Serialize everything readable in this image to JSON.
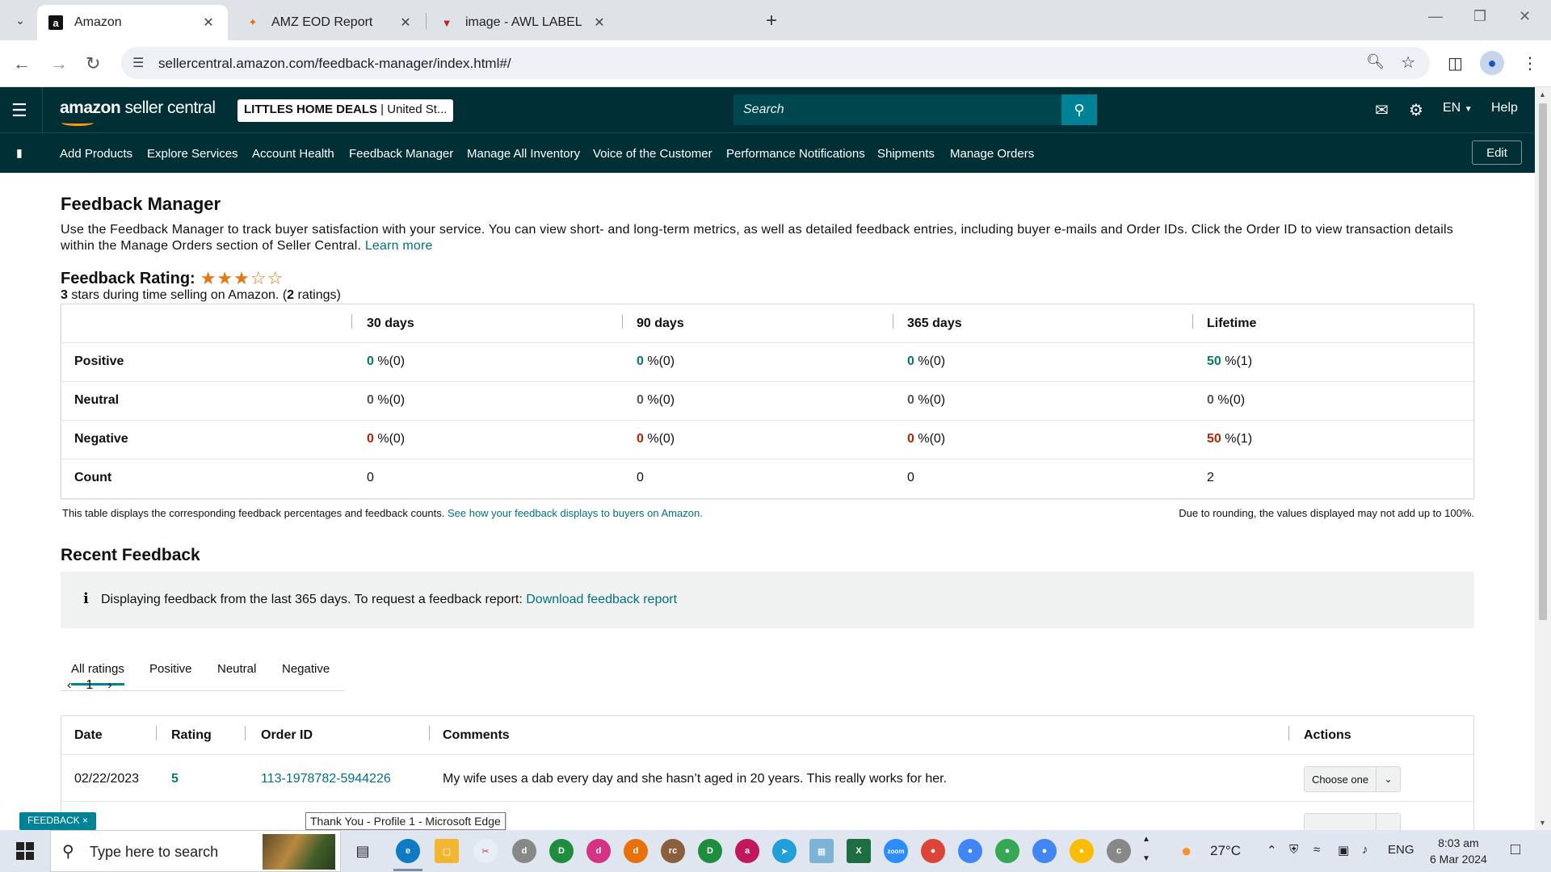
{
  "browser": {
    "tabs": [
      {
        "title": "Amazon",
        "icon": "amazon-favicon",
        "active": true
      },
      {
        "title": "AMZ EOD Report",
        "icon": "report-favicon",
        "active": false
      },
      {
        "title": "image - AWL LABEL",
        "icon": "awl-favicon",
        "active": false
      }
    ],
    "url": "sellercentral.amazon.com/feedback-manager/index.html#/"
  },
  "header": {
    "logo_bold": "amazon",
    "logo_rest": " seller central",
    "store_name": "LITTLES HOME DEALS",
    "store_region": "United St...",
    "search_placeholder": "Search",
    "language": "EN",
    "help": "Help"
  },
  "nav": {
    "items": [
      "Add Products",
      "Explore Services",
      "Account Health",
      "Feedback Manager",
      "Manage All Inventory",
      "Voice of the Customer",
      "Performance Notifications",
      "Shipments",
      "Manage Orders"
    ],
    "edit": "Edit"
  },
  "page": {
    "title": "Feedback Manager",
    "description": "Use the Feedback Manager to track buyer satisfaction with your service. You can view short- and long-term metrics, as well as detailed feedback entries, including buyer e-mails and Order IDs. Click the Order ID to view transaction details within the Manage Orders section of Seller Central.",
    "learn_more": "Learn more",
    "rating_label": "Feedback Rating:",
    "stars_filled": 3,
    "stars_total": 5,
    "rating_value": "3",
    "rating_mid": " stars during time selling on Amazon. (",
    "rating_count": "2",
    "rating_end": " ratings)"
  },
  "feedback_table": {
    "columns": [
      "30 days",
      "90 days",
      "365 days",
      "Lifetime"
    ],
    "rows": [
      {
        "label": "Positive",
        "values": [
          [
            "0",
            " %(0)"
          ],
          [
            "0",
            " %(0)"
          ],
          [
            "0",
            " %(0)"
          ],
          [
            "50",
            " %(1)"
          ]
        ]
      },
      {
        "label": "Neutral",
        "values": [
          [
            "0",
            " %(0)"
          ],
          [
            "0",
            " %(0)"
          ],
          [
            "0",
            " %(0)"
          ],
          [
            "0",
            " %(0)"
          ]
        ]
      },
      {
        "label": "Negative",
        "values": [
          [
            "0",
            " %(0)"
          ],
          [
            "0",
            " %(0)"
          ],
          [
            "0",
            " %(0)"
          ],
          [
            "50",
            " %(1)"
          ]
        ]
      },
      {
        "label": "Count",
        "values": [
          [
            "0"
          ],
          [
            "0"
          ],
          [
            "0"
          ],
          [
            "2"
          ]
        ]
      }
    ],
    "note": "This table displays the corresponding feedback percentages and feedback counts.",
    "note_link": "See how your feedback displays to buyers on Amazon.",
    "rounding_note": "Due to rounding, the values displayed may not add up to 100%."
  },
  "recent": {
    "title": "Recent Feedback",
    "info": "Displaying feedback from the last 365 days. To request a feedback report:",
    "download": "Download feedback report",
    "tabs": [
      "All ratings",
      "Positive",
      "Neutral",
      "Negative"
    ],
    "page": "1",
    "columns": [
      "Date",
      "Rating",
      "Order ID",
      "Comments",
      "Actions"
    ],
    "rows": [
      {
        "date": "02/22/2023",
        "rating": "5",
        "order_id": "113-1978782-5944226",
        "comment": "My wife uses a dab every day and she hasn’t aged in 20 years. This really works for her.",
        "action": "Choose one"
      },
      {
        "date": "",
        "rating": "",
        "order_id": "",
        "comment": "",
        "action": ""
      }
    ]
  },
  "overlay": {
    "feedback_badge": "FEEDBACK ×",
    "tooltip": "Thank You - Profile 1 - Microsoft Edge"
  },
  "taskbar": {
    "search_placeholder": "Type here to search",
    "weather": "27°C",
    "lang": "ENG",
    "time": "8:03 am",
    "date": "6 Mar 2024"
  },
  "colors": {
    "header_bg": "#002f36",
    "link": "#007185",
    "positive": "#067d62",
    "negative": "#b12704",
    "star": "#e47911",
    "accent": "#008296"
  }
}
